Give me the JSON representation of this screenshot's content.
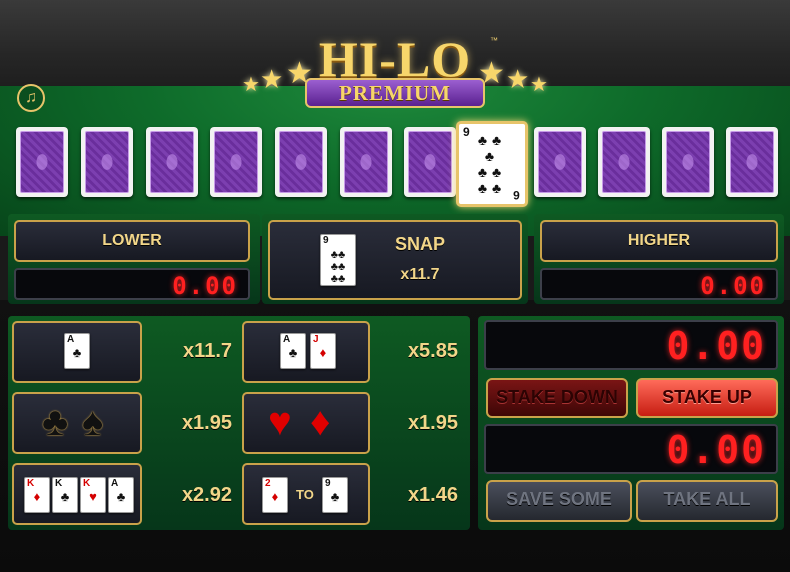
{
  "logo": {
    "title": "HI-LO",
    "tm": "™",
    "subtitle": "PREMIUM"
  },
  "icons": {
    "round_button": "music-note-icon",
    "star": "star-icon"
  },
  "current_card": {
    "rank": "9",
    "suit": "clubs",
    "symbol": "♣",
    "corner_bottom": "6"
  },
  "card_backs_count": 11,
  "bets": {
    "lower": {
      "label": "LOWER",
      "value": "0.00"
    },
    "snap": {
      "label": "SNAP",
      "multiplier": "x11.7",
      "card_rank": "9",
      "card_symbol": "♣"
    },
    "higher": {
      "label": "HIGHER",
      "value": "0.00"
    }
  },
  "side_bets": [
    {
      "id": "ace",
      "multiplier": "x11.7",
      "cards": [
        {
          "rank": "A",
          "symbol": "♣",
          "color": "black"
        }
      ]
    },
    {
      "id": "ace-jack",
      "multiplier": "x5.85",
      "cards": [
        {
          "rank": "A",
          "symbol": "♣",
          "color": "black"
        },
        {
          "rank": "J",
          "symbol": "♦",
          "color": "red"
        }
      ]
    },
    {
      "id": "black-suits",
      "multiplier": "x1.95",
      "suits": [
        "♣",
        "♠"
      ],
      "suit_color": "black"
    },
    {
      "id": "red-suits",
      "multiplier": "x1.95",
      "suits": [
        "♥",
        "♦"
      ],
      "suit_color": "red"
    },
    {
      "id": "face-cards",
      "multiplier": "x2.92",
      "cards": [
        {
          "rank": "K",
          "symbol": "♦",
          "color": "red"
        },
        {
          "rank": "K",
          "symbol": "♣",
          "color": "black"
        },
        {
          "rank": "K",
          "symbol": "♥",
          "color": "red"
        },
        {
          "rank": "A",
          "symbol": "♣",
          "color": "black"
        }
      ]
    },
    {
      "id": "range",
      "multiplier": "x1.46",
      "from": {
        "rank": "2",
        "symbol": "♦",
        "color": "red"
      },
      "to_label": "TO",
      "to": {
        "rank": "9",
        "symbol": "♣",
        "color": "black"
      }
    }
  ],
  "stake": {
    "value": "0.00",
    "down_label": "STAKE DOWN",
    "up_label": "STAKE UP"
  },
  "winnings": {
    "value": "0.00",
    "save_label": "SAVE SOME",
    "take_label": "TAKE ALL"
  },
  "colors": {
    "gold": "#c9a24a",
    "felt": "#0e6b2a",
    "led_red": "#ff2020",
    "purple": "#7c3fb0"
  }
}
